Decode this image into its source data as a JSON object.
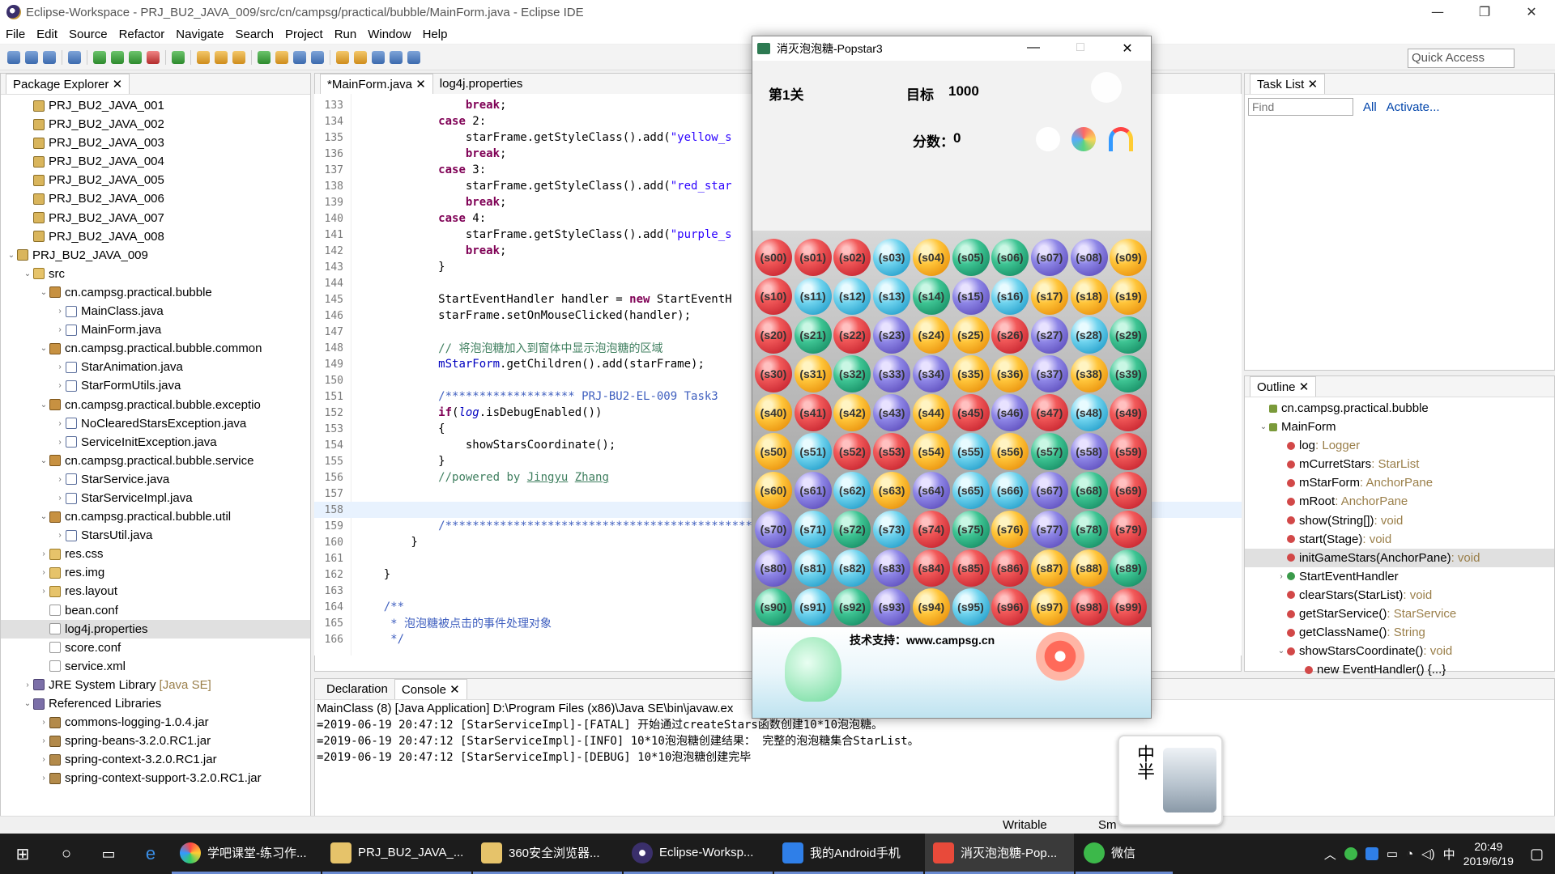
{
  "window": {
    "title": "Eclipse-Workspace - PRJ_BU2_JAVA_009/src/cn/campsg/practical/bubble/MainForm.java - Eclipse IDE",
    "minimize": "—",
    "maximize": "❐",
    "close": "✕"
  },
  "menu": [
    "File",
    "Edit",
    "Source",
    "Refactor",
    "Navigate",
    "Search",
    "Project",
    "Run",
    "Window",
    "Help"
  ],
  "toolbar": {
    "quick_access": "Quick Access"
  },
  "package_explorer": {
    "tab": "Package Explorer",
    "rows": [
      {
        "indent": 1,
        "tw": "",
        "icon": "proj",
        "label": "PRJ_BU2_JAVA_001"
      },
      {
        "indent": 1,
        "tw": "",
        "icon": "proj",
        "label": "PRJ_BU2_JAVA_002"
      },
      {
        "indent": 1,
        "tw": "",
        "icon": "proj",
        "label": "PRJ_BU2_JAVA_003"
      },
      {
        "indent": 1,
        "tw": "",
        "icon": "proj",
        "label": "PRJ_BU2_JAVA_004"
      },
      {
        "indent": 1,
        "tw": "",
        "icon": "proj",
        "label": "PRJ_BU2_JAVA_005"
      },
      {
        "indent": 1,
        "tw": "",
        "icon": "proj",
        "label": "PRJ_BU2_JAVA_006"
      },
      {
        "indent": 1,
        "tw": "",
        "icon": "proj",
        "label": "PRJ_BU2_JAVA_007"
      },
      {
        "indent": 1,
        "tw": "",
        "icon": "proj",
        "label": "PRJ_BU2_JAVA_008"
      },
      {
        "indent": 0,
        "tw": "⌄",
        "icon": "proj",
        "label": "PRJ_BU2_JAVA_009"
      },
      {
        "indent": 1,
        "tw": "⌄",
        "icon": "folder",
        "label": "src"
      },
      {
        "indent": 2,
        "tw": "⌄",
        "icon": "pkg",
        "label": "cn.campsg.practical.bubble"
      },
      {
        "indent": 3,
        "tw": "›",
        "icon": "java",
        "label": "MainClass.java"
      },
      {
        "indent": 3,
        "tw": "›",
        "icon": "java",
        "label": "MainForm.java"
      },
      {
        "indent": 2,
        "tw": "⌄",
        "icon": "pkg",
        "label": "cn.campsg.practical.bubble.common"
      },
      {
        "indent": 3,
        "tw": "›",
        "icon": "java",
        "label": "StarAnimation.java"
      },
      {
        "indent": 3,
        "tw": "›",
        "icon": "java",
        "label": "StarFormUtils.java"
      },
      {
        "indent": 2,
        "tw": "⌄",
        "icon": "pkg",
        "label": "cn.campsg.practical.bubble.exceptio"
      },
      {
        "indent": 3,
        "tw": "›",
        "icon": "java",
        "label": "NoClearedStarsException.java"
      },
      {
        "indent": 3,
        "tw": "›",
        "icon": "java",
        "label": "ServiceInitException.java"
      },
      {
        "indent": 2,
        "tw": "⌄",
        "icon": "pkg",
        "label": "cn.campsg.practical.bubble.service"
      },
      {
        "indent": 3,
        "tw": "›",
        "icon": "java",
        "label": "StarService.java"
      },
      {
        "indent": 3,
        "tw": "›",
        "icon": "java",
        "label": "StarServiceImpl.java"
      },
      {
        "indent": 2,
        "tw": "⌄",
        "icon": "pkg",
        "label": "cn.campsg.practical.bubble.util"
      },
      {
        "indent": 3,
        "tw": "›",
        "icon": "java",
        "label": "StarsUtil.java"
      },
      {
        "indent": 2,
        "tw": "›",
        "icon": "folder",
        "label": "res.css"
      },
      {
        "indent": 2,
        "tw": "›",
        "icon": "folder",
        "label": "res.img"
      },
      {
        "indent": 2,
        "tw": "›",
        "icon": "folder",
        "label": "res.layout"
      },
      {
        "indent": 2,
        "tw": "",
        "icon": "file",
        "label": "bean.conf"
      },
      {
        "indent": 2,
        "tw": "",
        "icon": "file",
        "label": "log4j.properties",
        "selected": true
      },
      {
        "indent": 2,
        "tw": "",
        "icon": "file",
        "label": "score.conf"
      },
      {
        "indent": 2,
        "tw": "",
        "icon": "file",
        "label": "service.xml"
      },
      {
        "indent": 1,
        "tw": "›",
        "icon": "lib",
        "label": "JRE System Library",
        "suffix": "[Java SE]"
      },
      {
        "indent": 1,
        "tw": "⌄",
        "icon": "lib",
        "label": "Referenced Libraries"
      },
      {
        "indent": 2,
        "tw": "›",
        "icon": "jar",
        "label": "commons-logging-1.0.4.jar"
      },
      {
        "indent": 2,
        "tw": "›",
        "icon": "jar",
        "label": "spring-beans-3.2.0.RC1.jar"
      },
      {
        "indent": 2,
        "tw": "›",
        "icon": "jar",
        "label": "spring-context-3.2.0.RC1.jar"
      },
      {
        "indent": 2,
        "tw": "›",
        "icon": "jar",
        "label": "spring-context-support-3.2.0.RC1.jar"
      }
    ]
  },
  "editor": {
    "tabs": [
      "*MainForm.java",
      "log4j.properties"
    ],
    "current_line": "158",
    "lines": [
      {
        "n": "133",
        "h": "                <span class='kw'>break</span>;"
      },
      {
        "n": "134",
        "h": "            <span class='kw'>case</span> 2:"
      },
      {
        "n": "135",
        "h": "                starFrame.getStyleClass().add(<span class='str'>\"yellow_s</span>"
      },
      {
        "n": "136",
        "h": "                <span class='kw'>break</span>;"
      },
      {
        "n": "137",
        "h": "            <span class='kw'>case</span> 3:"
      },
      {
        "n": "138",
        "h": "                starFrame.getStyleClass().add(<span class='str'>\"red_star</span>"
      },
      {
        "n": "139",
        "h": "                <span class='kw'>break</span>;"
      },
      {
        "n": "140",
        "h": "            <span class='kw'>case</span> 4:"
      },
      {
        "n": "141",
        "h": "                starFrame.getStyleClass().add(<span class='str'>\"purple_s</span>"
      },
      {
        "n": "142",
        "h": "                <span class='kw'>break</span>;"
      },
      {
        "n": "143",
        "h": "            }"
      },
      {
        "n": "144",
        "h": ""
      },
      {
        "n": "145",
        "h": "            StartEventHandler handler = <span class='kw'>new</span> StartEventH"
      },
      {
        "n": "146",
        "h": "            starFrame.setOnMouseClicked(handler);"
      },
      {
        "n": "147",
        "h": ""
      },
      {
        "n": "148",
        "h": "            <span class='cmt'>// 将泡泡糖加入到窗体中显示泡泡糖的区域</span>"
      },
      {
        "n": "149",
        "h": "            <span class='fld'>mStarForm</span>.getChildren().add(starFrame);"
      },
      {
        "n": "150",
        "h": ""
      },
      {
        "n": "151",
        "h": "            <span class='jd'>/******************* PRJ-BU2-EL-009 Task3</span>"
      },
      {
        "n": "152",
        "h": "            <span class='kw'>if</span>(<span class='fld it'>log</span>.isDebugEnabled())"
      },
      {
        "n": "153",
        "h": "            {"
      },
      {
        "n": "154",
        "h": "                showStarsCoordinate();"
      },
      {
        "n": "155",
        "h": "            }"
      },
      {
        "n": "156",
        "h": "            <span class='cmt'>//powered by <u>Jingyu</u> <u>Zhang</u></span>"
      },
      {
        "n": "157",
        "h": ""
      },
      {
        "n": "158",
        "h": ""
      },
      {
        "n": "159",
        "h": "            <span class='jd'>/***********************************************</span>"
      },
      {
        "n": "160",
        "h": "        }"
      },
      {
        "n": "161",
        "h": ""
      },
      {
        "n": "162",
        "h": "    }"
      },
      {
        "n": "163",
        "h": ""
      },
      {
        "n": "164",
        "h": "    <span class='jd'>/**</span>"
      },
      {
        "n": "165",
        "h": "<span class='jd'>     * 泡泡糖被点击的事件处理对象</span>"
      },
      {
        "n": "166",
        "h": "<span class='jd'>     */</span>"
      }
    ]
  },
  "task_list": {
    "tab": "Task List",
    "find_placeholder": "Find",
    "all": "All",
    "activate": "Activate..."
  },
  "outline": {
    "tab": "Outline",
    "rows": [
      {
        "indent": 0,
        "label": "cn.campsg.practical.bubble",
        "type": ""
      },
      {
        "indent": 0,
        "label": "MainForm",
        "type": "",
        "tw": "⌄"
      },
      {
        "indent": 1,
        "label": "log",
        "type": " : Logger"
      },
      {
        "indent": 1,
        "label": "mCurretStars",
        "type": " : StarList"
      },
      {
        "indent": 1,
        "label": "mStarForm",
        "type": " : AnchorPane"
      },
      {
        "indent": 1,
        "label": "mRoot",
        "type": " : AnchorPane"
      },
      {
        "indent": 1,
        "label": "show(String[])",
        "type": " : void"
      },
      {
        "indent": 1,
        "label": "start(Stage)",
        "type": " : void"
      },
      {
        "indent": 1,
        "label": "initGameStars(AnchorPane)",
        "type": " : void",
        "selected": true
      },
      {
        "indent": 1,
        "label": "StartEventHandler",
        "type": "",
        "tw": "›"
      },
      {
        "indent": 1,
        "label": "clearStars(StarList)",
        "type": " : void"
      },
      {
        "indent": 1,
        "label": "getStarService()",
        "type": " : StarService"
      },
      {
        "indent": 1,
        "label": "getClassName()",
        "type": " : String"
      },
      {
        "indent": 1,
        "label": "showStarsCoordinate()",
        "type": " : void",
        "tw": "⌄"
      },
      {
        "indent": 2,
        "label": "new EventHandler() {...}",
        "type": ""
      }
    ]
  },
  "console": {
    "tabs": [
      "Declaration",
      "Console"
    ],
    "header": "MainClass (8) [Java Application] D:\\Program Files (x86)\\Java SE\\bin\\javaw.ex",
    "lines": [
      "=2019-06-19 20:47:12 [StarServiceImpl]-[FATAL] 开始通过createStars函数创建10*10泡泡糖。",
      "=2019-06-19 20:47:12 [StarServiceImpl]-[INFO] 10*10泡泡糖创建结果： 完整的泡泡糖集合StarList。",
      "=2019-06-19 20:47:12 [StarServiceImpl]-[DEBUG] 10*10泡泡糖创建完毕"
    ]
  },
  "status": {
    "writable": "Writable",
    "smart": "Sm"
  },
  "popstar": {
    "title": "消灭泡泡糖-Popstar3",
    "level": "第1关",
    "target_label": "目标",
    "target_value": "1000",
    "score_label": "分数：",
    "score_value": "0",
    "support": "技术支持：www.campsg.cn",
    "grid": [
      [
        "red",
        "red",
        "red",
        "blue",
        "yellow",
        "green",
        "green",
        "purple",
        "purple",
        "yellow"
      ],
      [
        "red",
        "blue",
        "blue",
        "blue",
        "green",
        "purple",
        "blue",
        "yellow",
        "yellow",
        "yellow"
      ],
      [
        "red",
        "green",
        "red",
        "purple",
        "yellow",
        "yellow",
        "red",
        "purple",
        "blue",
        "green"
      ],
      [
        "red",
        "yellow",
        "green",
        "purple",
        "purple",
        "yellow",
        "yellow",
        "purple",
        "yellow",
        "green"
      ],
      [
        "yellow",
        "red",
        "yellow",
        "purple",
        "yellow",
        "red",
        "purple",
        "red",
        "blue",
        "red"
      ],
      [
        "yellow",
        "blue",
        "red",
        "red",
        "yellow",
        "blue",
        "yellow",
        "green",
        "purple",
        "red"
      ],
      [
        "yellow",
        "purple",
        "blue",
        "yellow",
        "purple",
        "blue",
        "blue",
        "purple",
        "green",
        "red"
      ],
      [
        "purple",
        "blue",
        "green",
        "blue",
        "red",
        "green",
        "yellow",
        "purple",
        "green",
        "red"
      ],
      [
        "purple",
        "blue",
        "blue",
        "purple",
        "red",
        "red",
        "red",
        "yellow",
        "yellow",
        "green"
      ],
      [
        "green",
        "blue",
        "green",
        "purple",
        "yellow",
        "blue",
        "red",
        "yellow",
        "red",
        "red"
      ]
    ]
  },
  "overlay_picture": {
    "text": "中半"
  },
  "taskbar": {
    "items": [
      "学吧课堂-练习作...",
      "PRJ_BU2_JAVA_...",
      "360安全浏览器...",
      "Eclipse-Worksp...",
      "我的Android手机",
      "消灭泡泡糖-Pop...",
      "微信"
    ],
    "time": "20:49",
    "date": "2019/6/19",
    "ime": "中"
  },
  "colors": {
    "selection": "#e0e0e0",
    "current_line": "#e8f2fe",
    "keyword": "#7f0055",
    "string": "#2a00ff",
    "comment": "#3f7f5f"
  }
}
